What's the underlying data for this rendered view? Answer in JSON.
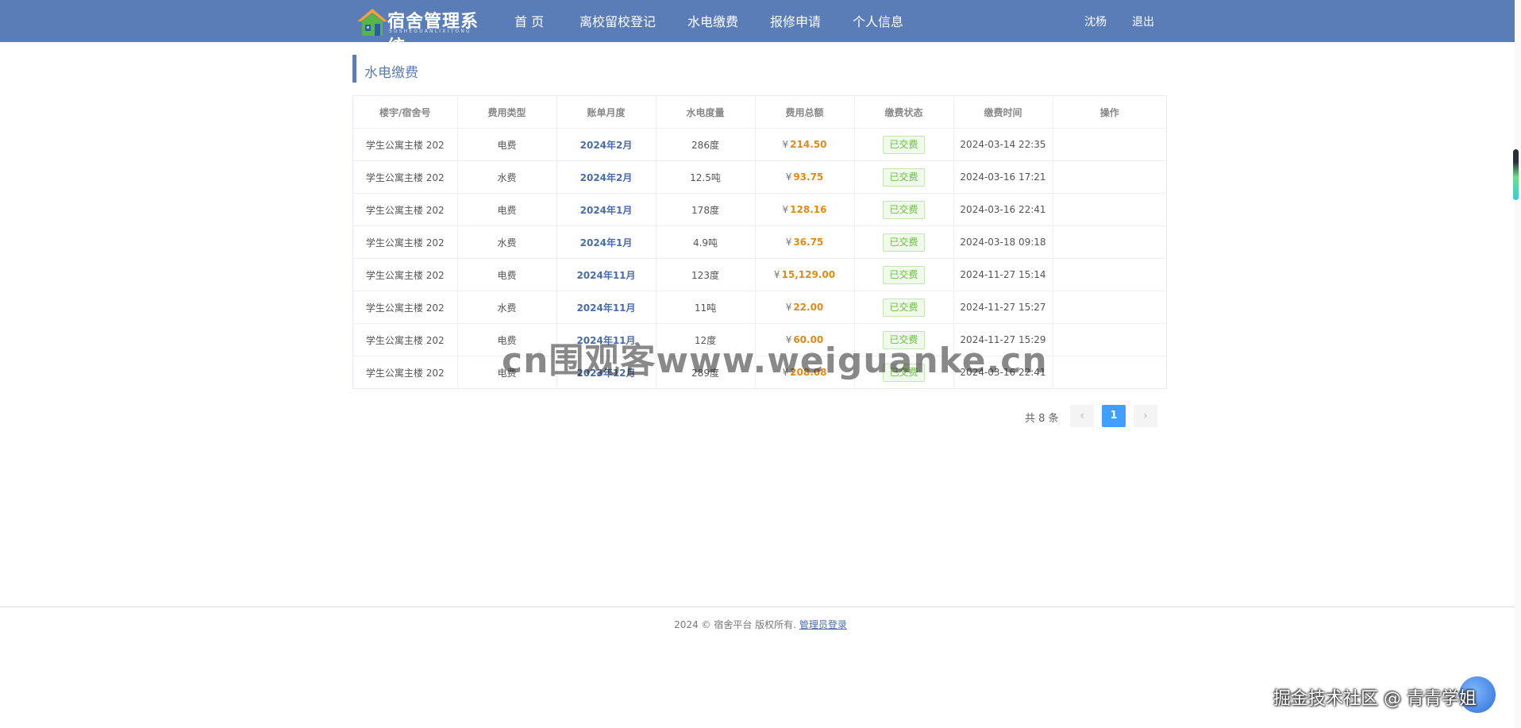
{
  "header": {
    "brand_title": "宿舍管理系统",
    "brand_subtitle": "SUSHEGUANLIXITONG",
    "nav": [
      "首 页",
      "离校留校登记",
      "水电缴费",
      "报修申请",
      "个人信息"
    ],
    "user_name": "沈杨",
    "logout": "退出"
  },
  "page": {
    "section_title": "水电缴费"
  },
  "table": {
    "columns": [
      "楼宇/宿舍号",
      "费用类型",
      "账单月度",
      "水电度量",
      "费用总额",
      "缴费状态",
      "缴费时间",
      "操作"
    ],
    "currency_symbol": "¥",
    "rows": [
      {
        "room": "学生公寓主楼 202",
        "type": "电费",
        "month": "2024年2月",
        "usage": "286度",
        "amount": "214.50",
        "status": "已交费",
        "time": "2024-03-14 22:35",
        "action": ""
      },
      {
        "room": "学生公寓主楼 202",
        "type": "水费",
        "month": "2024年2月",
        "usage": "12.5吨",
        "amount": "93.75",
        "status": "已交费",
        "time": "2024-03-16 17:21",
        "action": ""
      },
      {
        "room": "学生公寓主楼 202",
        "type": "电费",
        "month": "2024年1月",
        "usage": "178度",
        "amount": "128.16",
        "status": "已交费",
        "time": "2024-03-16 22:41",
        "action": ""
      },
      {
        "room": "学生公寓主楼 202",
        "type": "水费",
        "month": "2024年1月",
        "usage": "4.9吨",
        "amount": "36.75",
        "status": "已交费",
        "time": "2024-03-18 09:18",
        "action": ""
      },
      {
        "room": "学生公寓主楼 202",
        "type": "电费",
        "month": "2024年11月",
        "usage": "123度",
        "amount": "15,129.00",
        "status": "已交费",
        "time": "2024-11-27 15:14",
        "action": ""
      },
      {
        "room": "学生公寓主楼 202",
        "type": "水费",
        "month": "2024年11月",
        "usage": "11吨",
        "amount": "22.00",
        "status": "已交费",
        "time": "2024-11-27 15:27",
        "action": ""
      },
      {
        "room": "学生公寓主楼 202",
        "type": "电费",
        "month": "2024年11月",
        "usage": "12度",
        "amount": "60.00",
        "status": "已交费",
        "time": "2024-11-27 15:29",
        "action": ""
      },
      {
        "room": "学生公寓主楼 202",
        "type": "电费",
        "month": "2023年12月",
        "usage": "289度",
        "amount": "208.08",
        "status": "已交费",
        "time": "2024-03-16 22:41",
        "action": ""
      }
    ]
  },
  "pagination": {
    "total_text": "共 8 条",
    "prev_icon": "chevron-left-icon",
    "next_icon": "chevron-right-icon",
    "prev_glyph": "‹",
    "next_glyph": "›",
    "current_page": "1"
  },
  "footer": {
    "text": "2024 © 宿舍平台 版权所有.",
    "admin_link": "管理员登录"
  },
  "watermarks": {
    "center": "cn围观客www.weiguanke.cn",
    "corner": "掘金技术社区 @ 青青学姐"
  },
  "colors": {
    "navbar": "#5b7db7",
    "accent": "#5b7db7",
    "month_text": "#4a6da8",
    "amount_text": "#e08a17",
    "status_green": "#67c23a",
    "page_active": "#409eff"
  }
}
